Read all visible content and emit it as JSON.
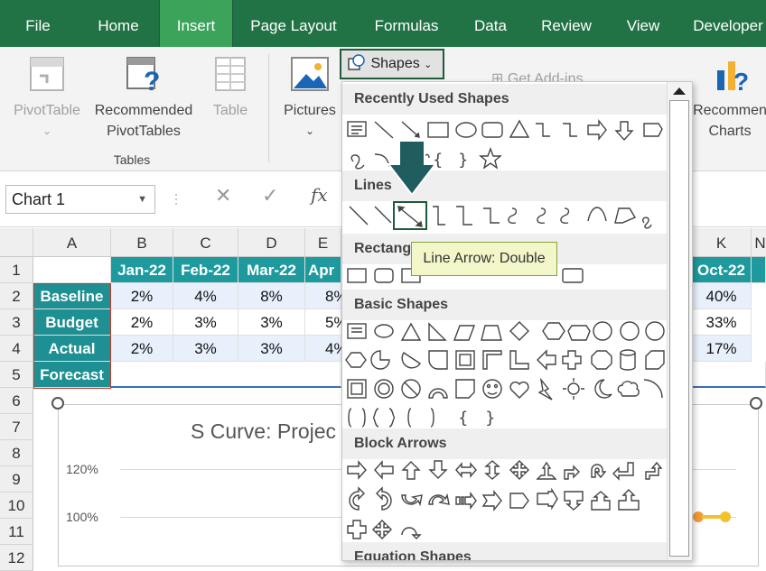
{
  "tabs": [
    {
      "label": "File"
    },
    {
      "label": "Home"
    },
    {
      "label": "Insert"
    },
    {
      "label": "Page Layout"
    },
    {
      "label": "Formulas"
    },
    {
      "label": "Data"
    },
    {
      "label": "Review"
    },
    {
      "label": "View"
    },
    {
      "label": "Developer"
    }
  ],
  "ribbon": {
    "pivottable": "PivotTable",
    "recommended_pivot_1": "Recommended",
    "recommended_pivot_2": "PivotTables",
    "table": "Table",
    "tables_group": "Tables",
    "pictures": "Pictures",
    "shapes": "Shapes",
    "get_addins": "Get Add-ins",
    "recommended_charts_1": "Recommen",
    "recommended_charts_2": "Charts"
  },
  "formula_bar": {
    "name_box": "Chart 1",
    "fx": "fx"
  },
  "columns": [
    "A",
    "B",
    "C",
    "D",
    "E",
    "K",
    "N"
  ],
  "rows": [
    "1",
    "2",
    "3",
    "4",
    "5",
    "6",
    "7",
    "8",
    "9",
    "10",
    "11",
    "12"
  ],
  "table": {
    "headers": [
      "Jan-22",
      "Feb-22",
      "Mar-22",
      "Apr",
      "Oct-22"
    ],
    "labels": [
      "Baseline",
      "Budget",
      "Actual",
      "Forecast"
    ],
    "baseline": [
      "2%",
      "4%",
      "8%",
      "8%",
      "40%"
    ],
    "budget": [
      "2%",
      "3%",
      "3%",
      "5%",
      "33%"
    ],
    "actual": [
      "2%",
      "3%",
      "3%",
      "4%",
      "17%"
    ]
  },
  "chart": {
    "title": "S Curve: Projec",
    "yticks": [
      "120%",
      "100%"
    ]
  },
  "shapes_menu": {
    "recent": "Recently Used Shapes",
    "lines": "Lines",
    "rectangles": "Rectangl",
    "basic": "Basic Shapes",
    "block": "Block Arrows",
    "equation": "Equation Shapes",
    "tooltip": "Line Arrow: Double"
  },
  "colors": {
    "ribbon_green": "#217346",
    "active_tab": "#3ba35a",
    "header_teal": "#1e9a9e"
  }
}
